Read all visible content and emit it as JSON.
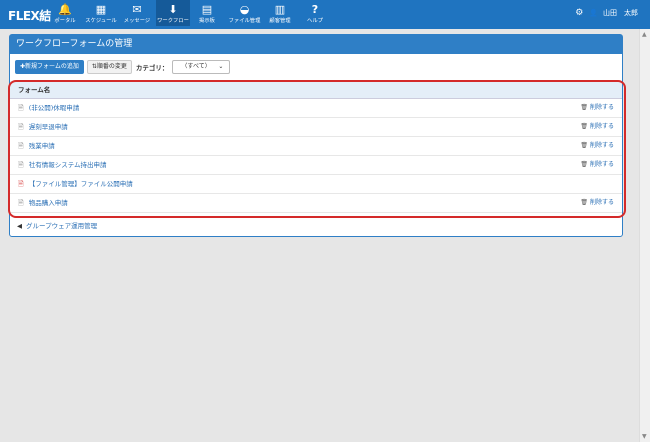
{
  "header": {
    "logo": "FLEX結",
    "nav": [
      {
        "label": "ポータル",
        "icon": "bell-icon",
        "glyph": "🔔"
      },
      {
        "label": "スケジュール",
        "icon": "calendar-icon",
        "glyph": "▦"
      },
      {
        "label": "メッセージ",
        "icon": "envelope-icon",
        "glyph": "✉"
      },
      {
        "label": "ワークフロー",
        "icon": "workflow-icon",
        "glyph": "⬇"
      },
      {
        "label": "掲示板",
        "icon": "bulletin-icon",
        "glyph": "▤"
      },
      {
        "label": "ファイル管理",
        "icon": "folder-icon",
        "glyph": "◒"
      },
      {
        "label": "顧客管理",
        "icon": "customer-icon",
        "glyph": "▥"
      },
      {
        "label": "ヘルプ",
        "icon": "help-icon",
        "glyph": "?"
      }
    ],
    "user_name": "山田　太郎"
  },
  "panel": {
    "title": "ワークフローフォームの管理",
    "add_button": "✚新規フォームの追加",
    "order_button": "⇅順番の変更",
    "category_label": "カテゴリ：",
    "category_value": "（すべて）",
    "column_header": "フォーム名",
    "rows": [
      {
        "name": "(非公開)休暇申請",
        "delete": "削除する"
      },
      {
        "name": "遅刻早退申請",
        "delete": "削除する"
      },
      {
        "name": "残業申請",
        "delete": "削除する"
      },
      {
        "name": "社有情報システム持出申請",
        "delete": "削除する"
      },
      {
        "name": "【ファイル管理】ファイル公開申請",
        "delete": ""
      },
      {
        "name": "物品購入申請",
        "delete": "削除する"
      }
    ],
    "back_link": "グループウェア運用管理"
  },
  "colors": {
    "topbar": "#1f74c0",
    "panel_header": "#2f7fc6",
    "highlight": "#d42a2a",
    "link": "#2a6fb5"
  }
}
